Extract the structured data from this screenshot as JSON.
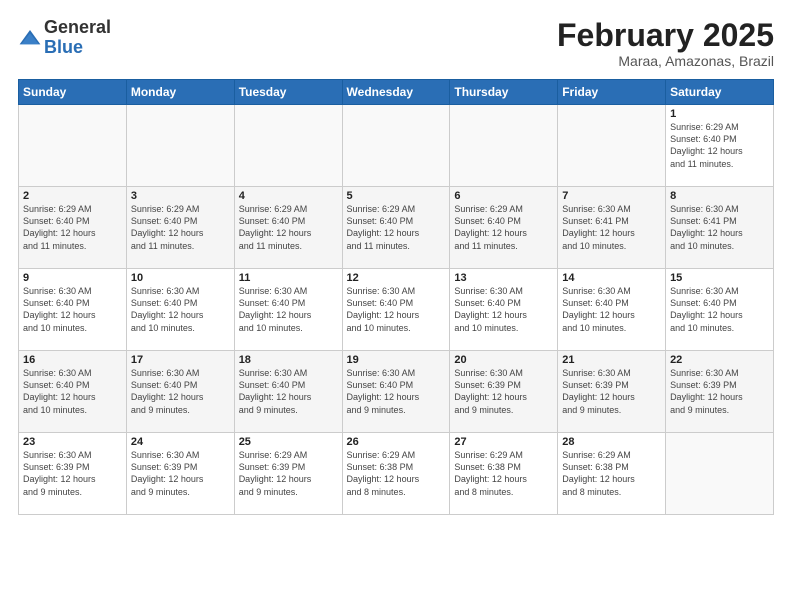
{
  "header": {
    "logo_general": "General",
    "logo_blue": "Blue",
    "title": "February 2025",
    "subtitle": "Maraa, Amazonas, Brazil"
  },
  "days_of_week": [
    "Sunday",
    "Monday",
    "Tuesday",
    "Wednesday",
    "Thursday",
    "Friday",
    "Saturday"
  ],
  "weeks": [
    [
      {
        "num": "",
        "info": ""
      },
      {
        "num": "",
        "info": ""
      },
      {
        "num": "",
        "info": ""
      },
      {
        "num": "",
        "info": ""
      },
      {
        "num": "",
        "info": ""
      },
      {
        "num": "",
        "info": ""
      },
      {
        "num": "1",
        "info": "Sunrise: 6:29 AM\nSunset: 6:40 PM\nDaylight: 12 hours\nand 11 minutes."
      }
    ],
    [
      {
        "num": "2",
        "info": "Sunrise: 6:29 AM\nSunset: 6:40 PM\nDaylight: 12 hours\nand 11 minutes."
      },
      {
        "num": "3",
        "info": "Sunrise: 6:29 AM\nSunset: 6:40 PM\nDaylight: 12 hours\nand 11 minutes."
      },
      {
        "num": "4",
        "info": "Sunrise: 6:29 AM\nSunset: 6:40 PM\nDaylight: 12 hours\nand 11 minutes."
      },
      {
        "num": "5",
        "info": "Sunrise: 6:29 AM\nSunset: 6:40 PM\nDaylight: 12 hours\nand 11 minutes."
      },
      {
        "num": "6",
        "info": "Sunrise: 6:29 AM\nSunset: 6:40 PM\nDaylight: 12 hours\nand 11 minutes."
      },
      {
        "num": "7",
        "info": "Sunrise: 6:30 AM\nSunset: 6:41 PM\nDaylight: 12 hours\nand 10 minutes."
      },
      {
        "num": "8",
        "info": "Sunrise: 6:30 AM\nSunset: 6:41 PM\nDaylight: 12 hours\nand 10 minutes."
      }
    ],
    [
      {
        "num": "9",
        "info": "Sunrise: 6:30 AM\nSunset: 6:40 PM\nDaylight: 12 hours\nand 10 minutes."
      },
      {
        "num": "10",
        "info": "Sunrise: 6:30 AM\nSunset: 6:40 PM\nDaylight: 12 hours\nand 10 minutes."
      },
      {
        "num": "11",
        "info": "Sunrise: 6:30 AM\nSunset: 6:40 PM\nDaylight: 12 hours\nand 10 minutes."
      },
      {
        "num": "12",
        "info": "Sunrise: 6:30 AM\nSunset: 6:40 PM\nDaylight: 12 hours\nand 10 minutes."
      },
      {
        "num": "13",
        "info": "Sunrise: 6:30 AM\nSunset: 6:40 PM\nDaylight: 12 hours\nand 10 minutes."
      },
      {
        "num": "14",
        "info": "Sunrise: 6:30 AM\nSunset: 6:40 PM\nDaylight: 12 hours\nand 10 minutes."
      },
      {
        "num": "15",
        "info": "Sunrise: 6:30 AM\nSunset: 6:40 PM\nDaylight: 12 hours\nand 10 minutes."
      }
    ],
    [
      {
        "num": "16",
        "info": "Sunrise: 6:30 AM\nSunset: 6:40 PM\nDaylight: 12 hours\nand 10 minutes."
      },
      {
        "num": "17",
        "info": "Sunrise: 6:30 AM\nSunset: 6:40 PM\nDaylight: 12 hours\nand 9 minutes."
      },
      {
        "num": "18",
        "info": "Sunrise: 6:30 AM\nSunset: 6:40 PM\nDaylight: 12 hours\nand 9 minutes."
      },
      {
        "num": "19",
        "info": "Sunrise: 6:30 AM\nSunset: 6:40 PM\nDaylight: 12 hours\nand 9 minutes."
      },
      {
        "num": "20",
        "info": "Sunrise: 6:30 AM\nSunset: 6:39 PM\nDaylight: 12 hours\nand 9 minutes."
      },
      {
        "num": "21",
        "info": "Sunrise: 6:30 AM\nSunset: 6:39 PM\nDaylight: 12 hours\nand 9 minutes."
      },
      {
        "num": "22",
        "info": "Sunrise: 6:30 AM\nSunset: 6:39 PM\nDaylight: 12 hours\nand 9 minutes."
      }
    ],
    [
      {
        "num": "23",
        "info": "Sunrise: 6:30 AM\nSunset: 6:39 PM\nDaylight: 12 hours\nand 9 minutes."
      },
      {
        "num": "24",
        "info": "Sunrise: 6:30 AM\nSunset: 6:39 PM\nDaylight: 12 hours\nand 9 minutes."
      },
      {
        "num": "25",
        "info": "Sunrise: 6:29 AM\nSunset: 6:39 PM\nDaylight: 12 hours\nand 9 minutes."
      },
      {
        "num": "26",
        "info": "Sunrise: 6:29 AM\nSunset: 6:38 PM\nDaylight: 12 hours\nand 8 minutes."
      },
      {
        "num": "27",
        "info": "Sunrise: 6:29 AM\nSunset: 6:38 PM\nDaylight: 12 hours\nand 8 minutes."
      },
      {
        "num": "28",
        "info": "Sunrise: 6:29 AM\nSunset: 6:38 PM\nDaylight: 12 hours\nand 8 minutes."
      },
      {
        "num": "",
        "info": ""
      }
    ]
  ]
}
